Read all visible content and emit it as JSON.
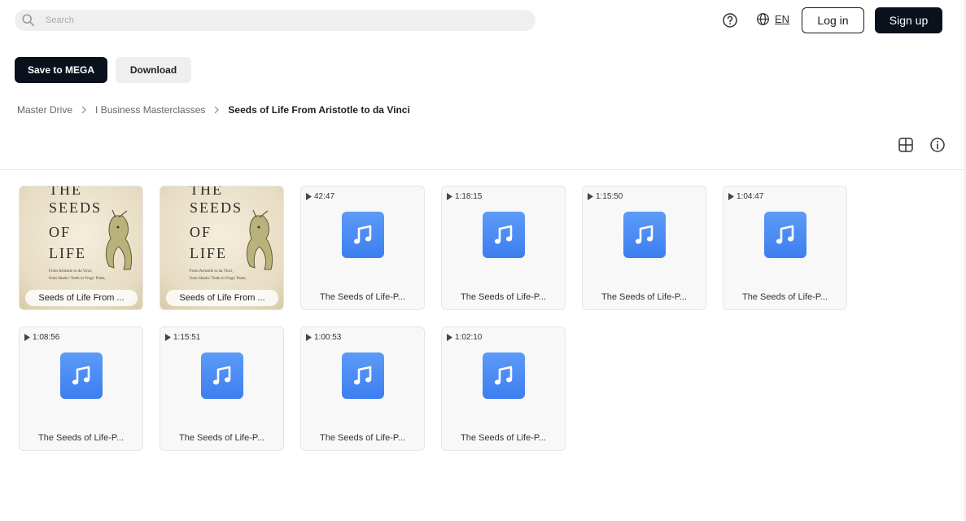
{
  "header": {
    "search_placeholder": "Search",
    "language": "EN",
    "login_label": "Log in",
    "signup_label": "Sign up"
  },
  "actions": {
    "save_label": "Save to MEGA",
    "download_label": "Download"
  },
  "breadcrumb": {
    "items": [
      "Master Drive",
      "I Business Masterclasses"
    ],
    "current": "Seeds of Life From Aristotle to da Vinci"
  },
  "cover_text": {
    "line1": "THE",
    "line2": "SEEDS",
    "line3": "OF",
    "line4": "LIFE",
    "sub1": "From Aristotle to da Vinci,",
    "sub2": "from Sharks' Teeth to Frogs' Pants,"
  },
  "files": [
    {
      "type": "image",
      "name": "Seeds of Life From ..."
    },
    {
      "type": "image",
      "name": "Seeds of Life From ..."
    },
    {
      "type": "audio",
      "duration": "42:47",
      "name": "The Seeds of Life-P..."
    },
    {
      "type": "audio",
      "duration": "1:18:15",
      "name": "The Seeds of Life-P..."
    },
    {
      "type": "audio",
      "duration": "1:15:50",
      "name": "The Seeds of Life-P..."
    },
    {
      "type": "audio",
      "duration": "1:04:47",
      "name": "The Seeds of Life-P..."
    },
    {
      "type": "audio",
      "duration": "1:08:56",
      "name": "The Seeds of Life-P..."
    },
    {
      "type": "audio",
      "duration": "1:15:51",
      "name": "The Seeds of Life-P..."
    },
    {
      "type": "audio",
      "duration": "1:00:53",
      "name": "The Seeds of Life-P..."
    },
    {
      "type": "audio",
      "duration": "1:02:10",
      "name": "The Seeds of Life-P..."
    }
  ],
  "icons": {
    "search": "search-icon",
    "help": "help-icon",
    "globe": "globe-icon",
    "view": "grid-view-icon",
    "info": "info-icon",
    "music": "music-note-icon",
    "play": "play-icon"
  },
  "colors": {
    "primary_dark": "#0b111c",
    "audio_icon": "#3d7ef0"
  }
}
